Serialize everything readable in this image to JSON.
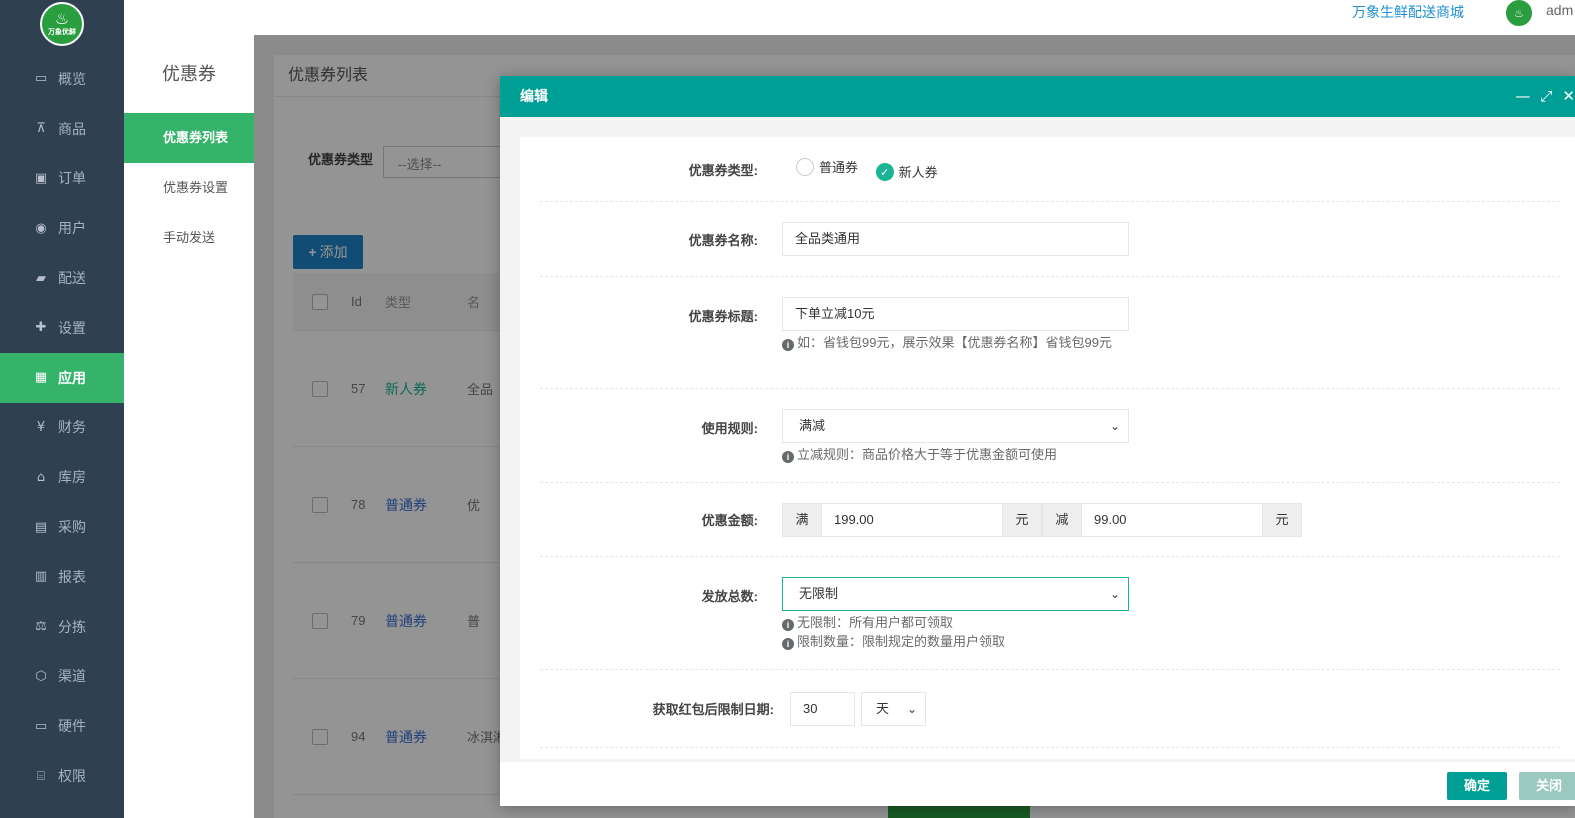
{
  "nav": {
    "logo_text": "万象优鲜",
    "items": [
      {
        "label": "概览",
        "icon": "monitor-icon"
      },
      {
        "label": "商品",
        "icon": "cart-icon"
      },
      {
        "label": "订单",
        "icon": "money-icon"
      },
      {
        "label": "用户",
        "icon": "users-icon"
      },
      {
        "label": "配送",
        "icon": "truck-icon"
      },
      {
        "label": "设置",
        "icon": "puzzle-icon"
      },
      {
        "label": "应用",
        "icon": "app-icon"
      },
      {
        "label": "财务",
        "icon": "yen-icon"
      },
      {
        "label": "库房",
        "icon": "home-icon"
      },
      {
        "label": "采购",
        "icon": "bus-icon"
      },
      {
        "label": "报表",
        "icon": "bar-chart-icon"
      },
      {
        "label": "分拣",
        "icon": "scale-icon"
      },
      {
        "label": "渠道",
        "icon": "cube-icon"
      },
      {
        "label": "硬件",
        "icon": "desktop-icon"
      },
      {
        "label": "权限",
        "icon": "bank-icon"
      }
    ],
    "active_index": 6
  },
  "topbar": {
    "shop_name": "万象生鲜配送商城",
    "user": "adm"
  },
  "subnav": {
    "title": "优惠券",
    "items": [
      "优惠券列表",
      "优惠券设置",
      "手动发送"
    ],
    "active_index": 0
  },
  "list": {
    "title": "优惠券列表",
    "filter_label": "优惠券类型",
    "filter_placeholder": "--选择--",
    "add_label": "添加",
    "columns": [
      "Id",
      "类型",
      "名"
    ],
    "rows": [
      {
        "id": "57",
        "type": "新人券",
        "name": "全品"
      },
      {
        "id": "78",
        "type": "普通券",
        "name": "优"
      },
      {
        "id": "79",
        "type": "普通券",
        "name": "普"
      },
      {
        "id": "94",
        "type": "普通券",
        "name": "冰淇淋"
      }
    ]
  },
  "modal": {
    "title": "编辑",
    "fields": {
      "type_label": "优惠券类型:",
      "type_options": [
        "普通券",
        "新人券"
      ],
      "type_selected": "新人券",
      "name_label": "优惠券名称:",
      "name_value": "全品类通用",
      "subtitle_label": "优惠券标题:",
      "subtitle_value": "下单立减10元",
      "subtitle_help": "如：省钱包99元，展示效果【优惠券名称】省钱包99元",
      "rule_label": "使用规则:",
      "rule_value": "满减",
      "rule_help": "立减规则：商品价格大于等于优惠金额可使用",
      "amount_label": "优惠金额:",
      "amount_full_prefix": "满",
      "amount_full_value": "199.00",
      "amount_unit1": "元",
      "amount_minus_prefix": "减",
      "amount_minus_value": "99.00",
      "amount_unit2": "元",
      "total_label": "发放总数:",
      "total_value": "无限制",
      "total_help1": "无限制：所有用户都可领取",
      "total_help2": "限制数量：限制规定的数量用户领取",
      "limit_label": "获取红包后限制日期:",
      "limit_value": "30",
      "limit_unit": "天"
    },
    "ok_label": "确定",
    "close_label": "关闭"
  },
  "colors": {
    "nav_bg": "#2f4050",
    "accent_green": "#36b36b",
    "modal_header": "#009f95"
  }
}
